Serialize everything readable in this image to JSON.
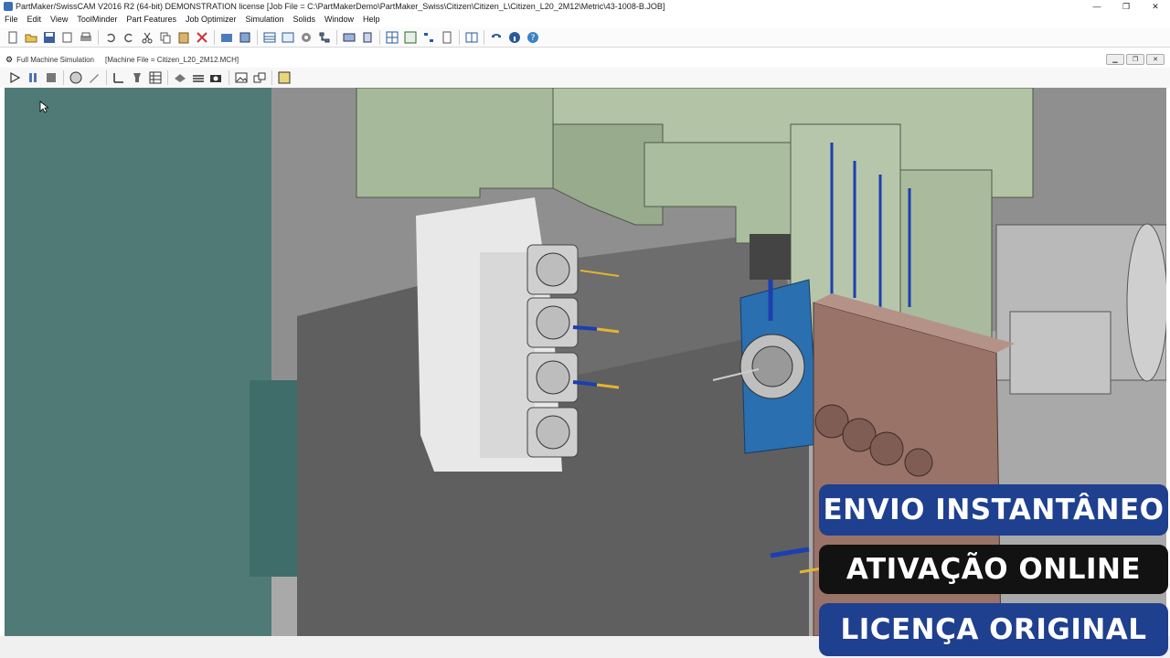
{
  "window": {
    "title": "PartMaker/SwissCAM V2016 R2 (64-bit) DEMONSTRATION license   [Job File = C:\\PartMakerDemo\\PartMaker_Swiss\\Citizen\\Citizen_L\\Citizen_L20_2M12\\Metric\\43-1008-B.JOB]",
    "controls": [
      "—",
      "❐",
      "✕"
    ]
  },
  "menu": [
    "File",
    "Edit",
    "View",
    "ToolMinder",
    "Part Features",
    "Job Optimizer",
    "Simulation",
    "Solids",
    "Window",
    "Help"
  ],
  "subwindow": {
    "title": "Full Machine Simulation",
    "machine_file": "[Machine File = Citizen_L20_2M12.MCH]",
    "controls": [
      "▁",
      "❐",
      "✕"
    ]
  },
  "banners": {
    "instant": "ENVIO INSTANTÂNEO",
    "online": "ATIVAÇÃO ONLINE",
    "license": "LICENÇA ORIGINAL"
  },
  "colors": {
    "accent_blue": "#1f3f8f",
    "banner_dark": "#121212",
    "machine_green": "#a6b99a",
    "spindle_teal": "#4f7a76",
    "tool_blue": "#2a6fb0",
    "plate_copper": "#9a7368"
  }
}
